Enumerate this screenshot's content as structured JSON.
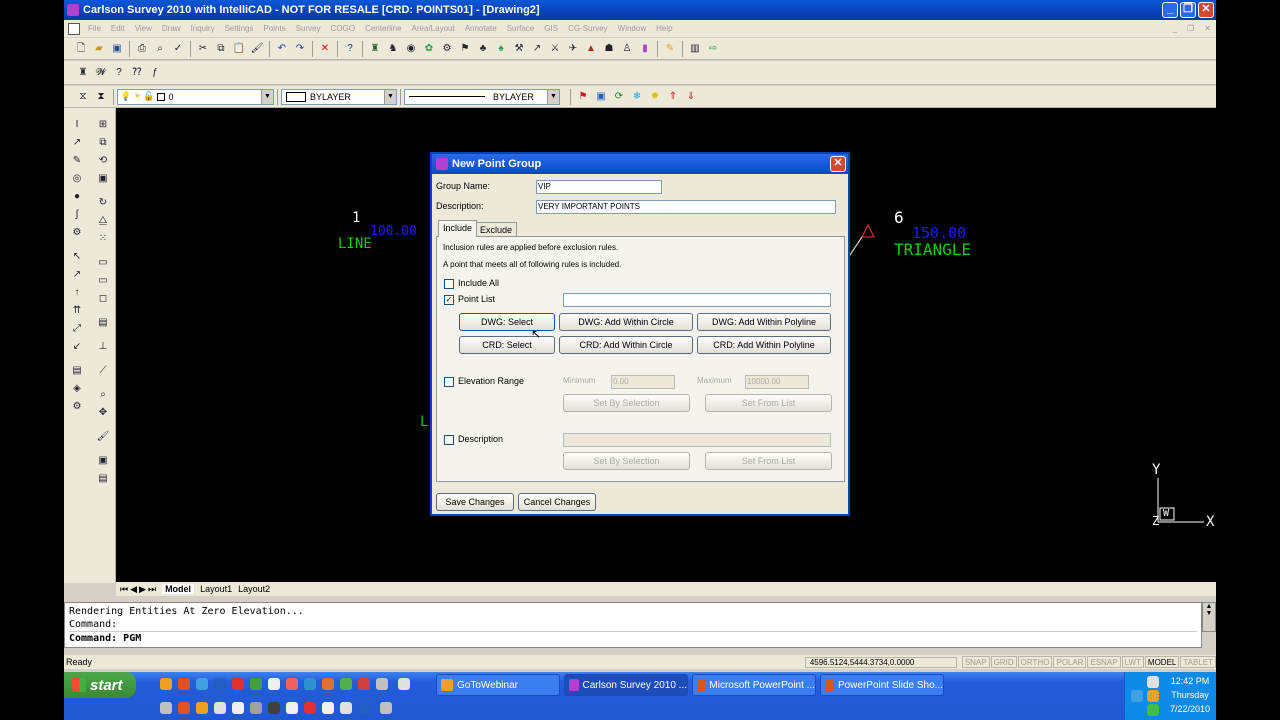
{
  "window": {
    "title": "Carlson Survey 2010 with IntelliCAD - NOT FOR RESALE [CRD: POINTS01] - [Drawing2]"
  },
  "menu": [
    "File",
    "Edit",
    "View",
    "Draw",
    "Inquiry",
    "Settings",
    "Points",
    "Survey",
    "COGO",
    "Centerline",
    "Area/Layout",
    "Annotate",
    "Surface",
    "GIS",
    "CG-Survey",
    "Window",
    "Help"
  ],
  "toolbar": {
    "layer_value": "0",
    "color_value": "BYLAYER",
    "linetype_value": "BYLAYER"
  },
  "canvas": {
    "point1_num": "1",
    "point1_elev": "100.00",
    "point1_desc": "LINE",
    "point6_num": "6",
    "point6_elev": "150.00",
    "point6_desc": "TRIANGLE",
    "stray_l": "L",
    "axis_y": "Y",
    "axis_x": "X",
    "axis_z": "Z",
    "axis_w": "W",
    "colors": {
      "num": "#ffffff",
      "elev": "#1a1aff",
      "desc": "#00d000",
      "tri": "#ff3030"
    }
  },
  "layout_tabs": [
    "Model",
    "Layout1",
    "Layout2"
  ],
  "command": {
    "lines": [
      "Rendering Entities At Zero Elevation...",
      "Command:"
    ],
    "prompt": "Command: PGM"
  },
  "status": {
    "ready": "Ready",
    "coords": "4596.5124,5444.3734,0.0000",
    "toggles": [
      "SNAP",
      "GRID",
      "ORTHO",
      "POLAR",
      "ESNAP",
      "LWT",
      "MODEL",
      "TABLET"
    ]
  },
  "dialog": {
    "title": "New Point Group",
    "group_name_label": "Group Name:",
    "group_name_value": "VIP",
    "description_label": "Description:",
    "description_value": "VERY IMPORTANT POINTS",
    "tabs": [
      "Include",
      "Exclude"
    ],
    "info1": "Inclusion rules are applied before exclusion rules.",
    "info2": "A point that meets all of following rules is included.",
    "include_all": "Include All",
    "point_list": "Point List",
    "btn_dwg_select": "DWG: Select",
    "btn_dwg_circle": "DWG: Add Within Circle",
    "btn_dwg_poly": "DWG: Add Within Polyline",
    "btn_crd_select": "CRD: Select",
    "btn_crd_circle": "CRD: Add Within Circle",
    "btn_crd_poly": "CRD: Add Within Polyline",
    "elevation_range": "Elevation Range",
    "minimum_label": "Minimum",
    "minimum_value": "0.00",
    "maximum_label": "Maximum",
    "maximum_value": "10000.00",
    "set_by_selection": "Set By Selection",
    "set_from_list": "Set From List",
    "description_rule": "Description",
    "save": "Save Changes",
    "cancel": "Cancel Changes"
  },
  "taskbar": {
    "start": "start",
    "tasks": [
      "GoToWebinar",
      "Carlson Survey 2010 ...",
      "Microsoft PowerPoint ...",
      "PowerPoint Slide Sho..."
    ],
    "time": "12:42 PM",
    "day": "Thursday",
    "date": "7/22/2010"
  }
}
